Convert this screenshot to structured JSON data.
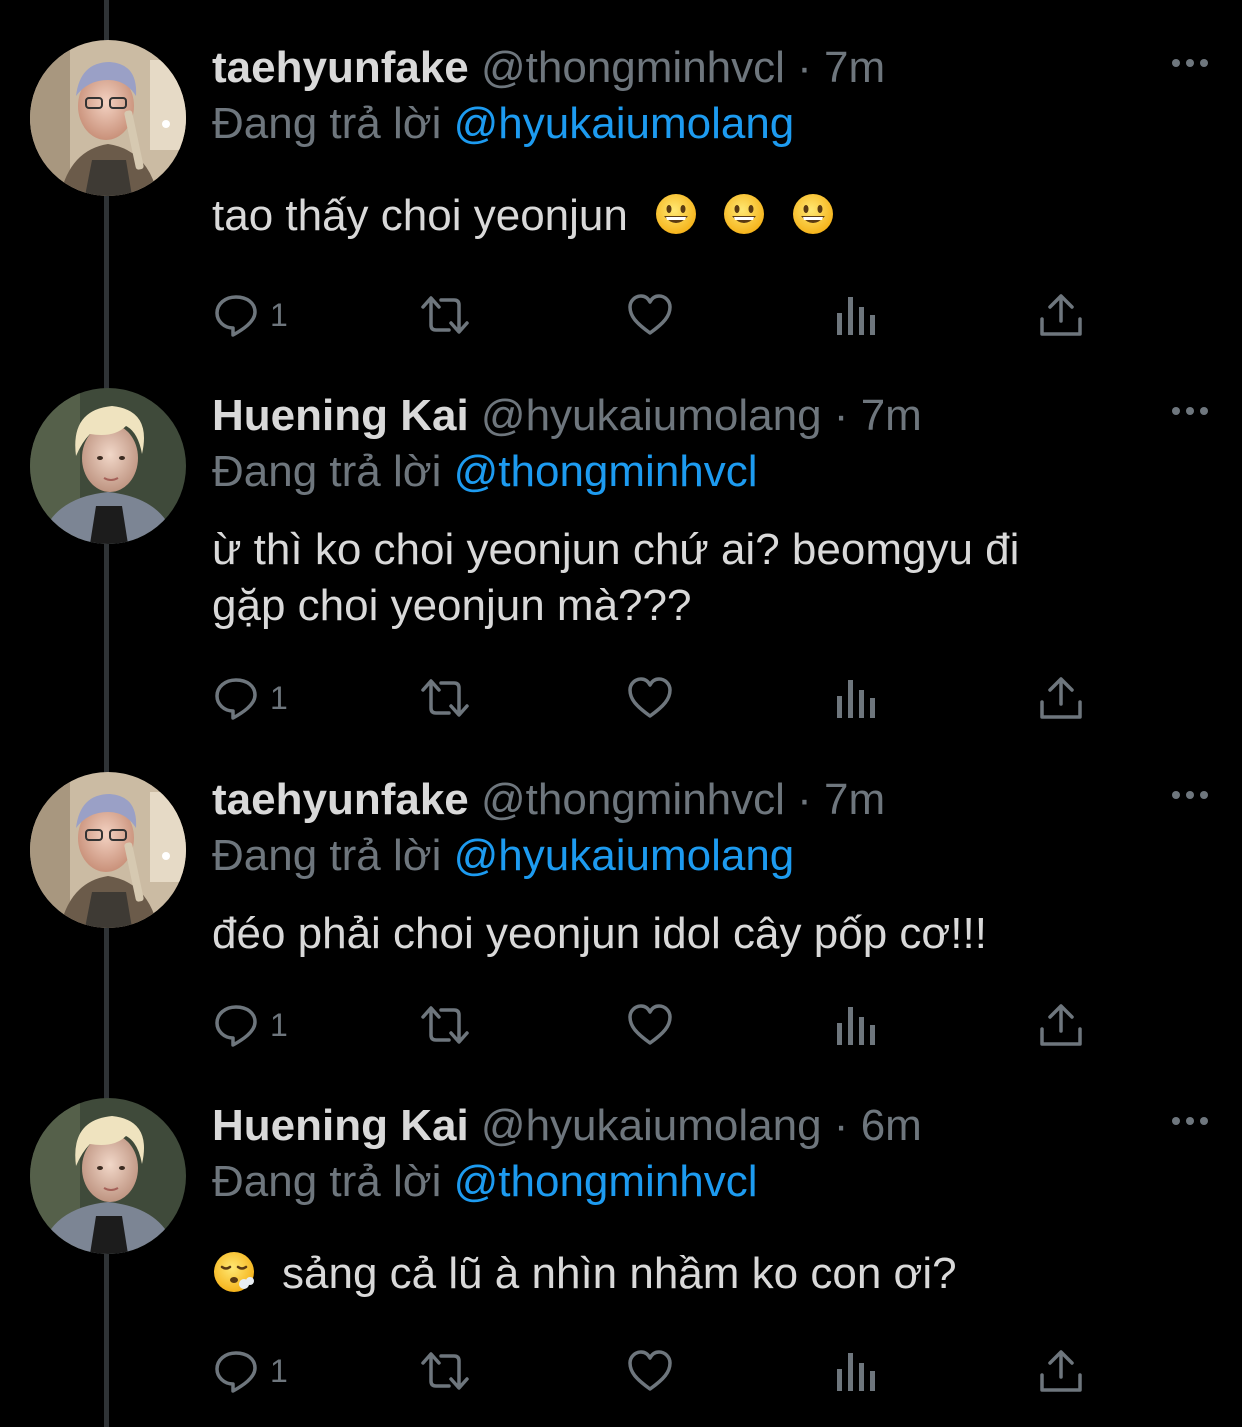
{
  "colors": {
    "background": "#000000",
    "name_text": "#d9d9d9",
    "secondary_text": "#6e767d",
    "mention_blue": "#1d9bf0",
    "thread_line": "#2f3336"
  },
  "tweets": [
    {
      "name": "taehyunfake",
      "handle": "@thongminhvcl",
      "separator": "·",
      "time": "7m",
      "reply_prefix": "Đang trả lời",
      "reply_to": "@hyukaiumolang",
      "text": "tao thấy choi yeonjun",
      "emoji": [
        "grinning-face",
        "grinning-face",
        "grinning-face"
      ],
      "reply_count": "1",
      "avatar": "taehyunfake-avatar"
    },
    {
      "name": "Huening Kai",
      "handle": "@hyukaiumolang",
      "separator": "·",
      "time": "7m",
      "reply_prefix": "Đang trả lời",
      "reply_to": "@thongminhvcl",
      "text_line1": "ừ thì ko choi yeonjun chứ ai? beomgyu đi",
      "text_line2": "gặp choi yeonjun mà???",
      "reply_count": "1",
      "avatar": "huening-kai-avatar"
    },
    {
      "name": "taehyunfake",
      "handle": "@thongminhvcl",
      "separator": "·",
      "time": "7m",
      "reply_prefix": "Đang trả lời",
      "reply_to": "@hyukaiumolang",
      "text": "đéo phải choi yeonjun idol cây pốp cơ!!!",
      "reply_count": "1",
      "avatar": "taehyunfake-avatar"
    },
    {
      "name": "Huening Kai",
      "handle": "@hyukaiumolang",
      "separator": "·",
      "time": "6m",
      "reply_prefix": "Đang trả lời",
      "reply_to": "@thongminhvcl",
      "text": "sảng cả lũ à nhìn nhầm ko con ơi?",
      "emoji": [
        "face-exhaling"
      ],
      "reply_count": "1",
      "avatar": "huening-kai-avatar"
    }
  ],
  "icons": {
    "reply": "reply-bubble-icon",
    "retweet": "retweet-icon",
    "like": "heart-icon",
    "views": "bar-chart-icon",
    "share": "share-icon",
    "more": "more-dots-icon"
  }
}
